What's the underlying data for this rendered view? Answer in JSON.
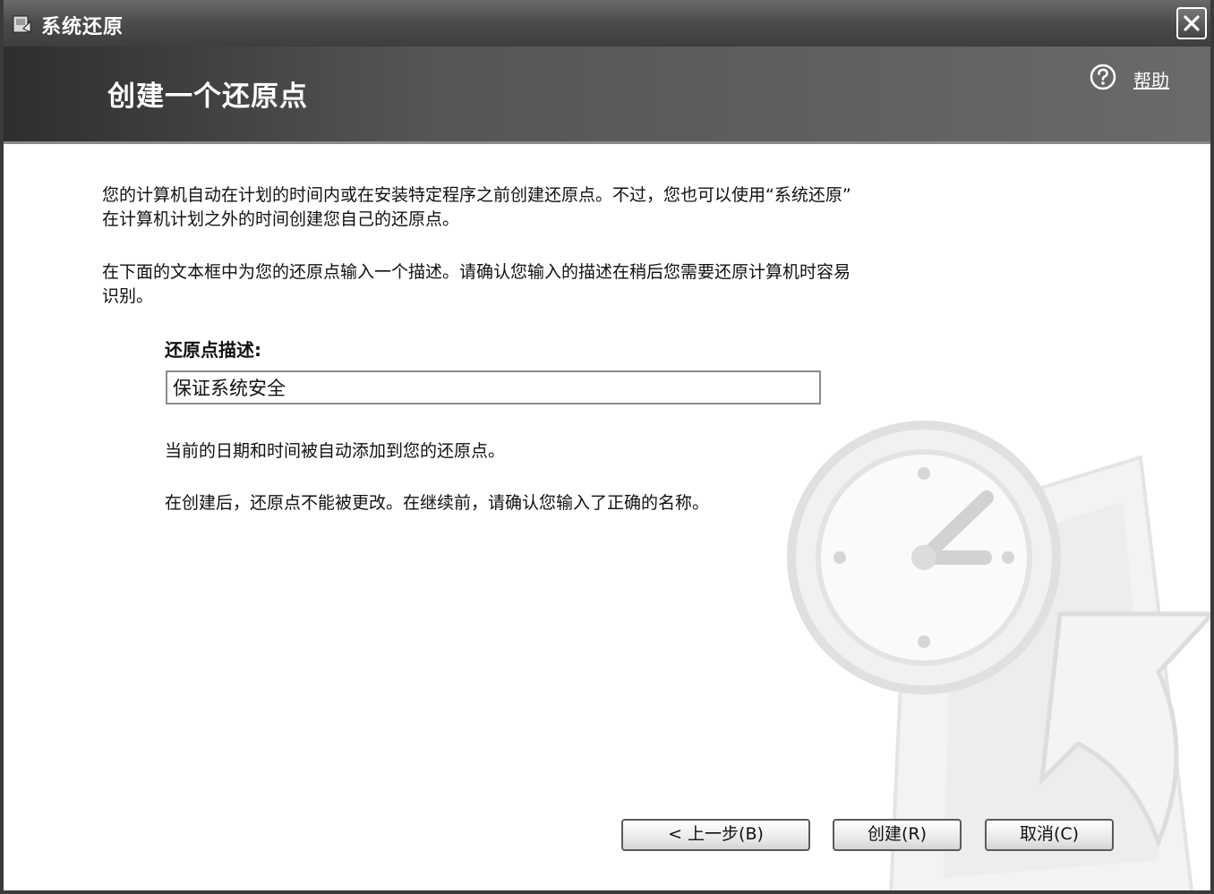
{
  "window": {
    "title": "系统还原",
    "close_icon": "close-icon"
  },
  "header": {
    "title": "创建一个还原点",
    "help_icon": "help-icon",
    "help_label": "帮助"
  },
  "content": {
    "paragraph1_line1": "您的计算机自动在计划的时间内或在安装特定程序之前创建还原点。不过，您也可以使用“系统还原”",
    "paragraph1_line2": "在计算机计划之外的时间创建您自己的还原点。",
    "paragraph2_line1": "在下面的文本框中为您的还原点输入一个描述。请确认您输入的描述在稍后您需要还原计算机时容易",
    "paragraph2_line2": "识别。",
    "description_label": "还原点描述:",
    "description_value": "保证系统安全",
    "note1": "当前的日期和时间被自动添加到您的还原点。",
    "note2": "在创建后，还原点不能被更改。在继续前，请确认您输入了正确的名称。"
  },
  "buttons": {
    "back": "< 上一步(B)",
    "create": "创建(R)",
    "cancel": "取消(C)"
  },
  "watermark_icon": "system-restore-clock-icon"
}
